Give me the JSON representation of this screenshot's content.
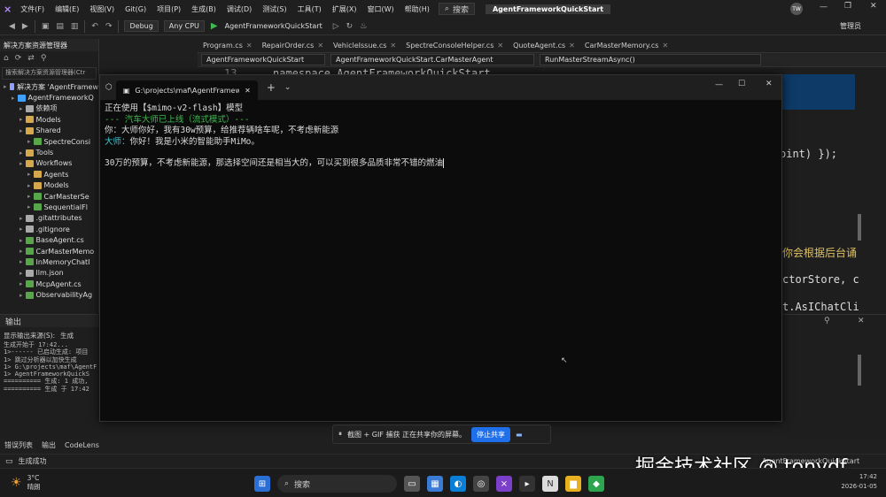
{
  "menubar": {
    "items": [
      "文件(F)",
      "编辑(E)",
      "视图(V)",
      "Git(G)",
      "项目(P)",
      "生成(B)",
      "调试(D)",
      "测试(S)",
      "工具(T)",
      "扩展(X)",
      "窗口(W)",
      "帮助(H)"
    ],
    "search_label": "搜索",
    "solution_title": "AgentFrameworkQuickStart",
    "avatar": "TW"
  },
  "toolbar": {
    "config": "Debug",
    "platform": "Any CPU",
    "run_target": "AgentFrameworkQuickStart",
    "admin": "管理员"
  },
  "solution_explorer": {
    "title": "解决方案资源管理器",
    "search_placeholder": "搜索解决方案资源管理器(Ctr",
    "items": [
      {
        "label": "解决方案 'AgentFramew",
        "indent": 0,
        "color": "#8fa0ff"
      },
      {
        "label": "AgentFrameworkQ",
        "indent": 1,
        "color": "#3fa0ff"
      },
      {
        "label": "依赖项",
        "indent": 2,
        "color": "#aaaaaa"
      },
      {
        "label": "Models",
        "indent": 2,
        "color": "#d4a84b"
      },
      {
        "label": "Shared",
        "indent": 2,
        "color": "#d4a84b"
      },
      {
        "label": "SpectreConsi",
        "indent": 3,
        "color": "#57a64a"
      },
      {
        "label": "Tools",
        "indent": 2,
        "color": "#d4a84b"
      },
      {
        "label": "Workflows",
        "indent": 2,
        "color": "#d4a84b"
      },
      {
        "label": "Agents",
        "indent": 3,
        "color": "#d4a84b"
      },
      {
        "label": "Models",
        "indent": 3,
        "color": "#d4a84b"
      },
      {
        "label": "CarMasterSe",
        "indent": 3,
        "color": "#57a64a"
      },
      {
        "label": "SequentialFl",
        "indent": 3,
        "color": "#57a64a"
      },
      {
        "label": ".gitattributes",
        "indent": 2,
        "color": "#aaaaaa"
      },
      {
        "label": ".gitignore",
        "indent": 2,
        "color": "#aaaaaa"
      },
      {
        "label": "BaseAgent.cs",
        "indent": 2,
        "color": "#57a64a"
      },
      {
        "label": "CarMasterMemo",
        "indent": 2,
        "color": "#57a64a"
      },
      {
        "label": "InMemoryChatI",
        "indent": 2,
        "color": "#57a64a"
      },
      {
        "label": "llm.json",
        "indent": 2,
        "color": "#aaaaaa"
      },
      {
        "label": "McpAgent.cs",
        "indent": 2,
        "color": "#57a64a"
      },
      {
        "label": "ObservabilityAg",
        "indent": 2,
        "color": "#57a64a"
      }
    ]
  },
  "editor": {
    "tabs": [
      "Program.cs",
      "RepairOrder.cs",
      "VehicleIssue.cs",
      "SpectreConsoleHelper.cs",
      "QuoteAgent.cs",
      "CarMasterMemory.cs"
    ],
    "nav": [
      "AgentFrameworkQuickStart",
      "AgentFrameworkQuickStart.CarMasterAgent",
      "RunMasterStreamAsync()"
    ],
    "frag1": "namespace AgentFrameworkQuickStart",
    "frag1_line": "13",
    "frag2": "oint) });",
    "frag3": "你会根据后台诵",
    "frag4": "ctorStore, c",
    "frag5": "t.AsIChatCli"
  },
  "terminal": {
    "tab_title": "G:\\projects\\maf\\AgentFramew",
    "line1": "正在使用【$mimo-v2-flash】模型",
    "line2": "--- 汽车大师已上线（流式模式）---",
    "line3": "你：大师你好，我有30w预算，给推荐辆啥车呢，不考虑新能源",
    "line4_prefix": "大师：",
    "line4": "你好！我是小米的智能助手MiMo。",
    "line5": "30万的预算，不考虑新能源，那选择空间还是相当大的，可以买到很多品质非常不错的燃油"
  },
  "output": {
    "title": "输出",
    "source_label": "显示输出来源(S):",
    "source_value": "生成",
    "lines": [
      "生成开始于 17:42...",
      "1>------ 已启动生成: 项目",
      "1>  跳过分析器以加快生成",
      "1>  G:\\projects\\maf\\AgentF",
      "1>  AgentFrameworkQuickS",
      "========== 生成: 1 成功,",
      "========== 生成 于 17:42"
    ]
  },
  "bottom_tabs": [
    "错误列表",
    "输出",
    "CodeLens"
  ],
  "status": {
    "text": "生成成功",
    "project": "AgentFrameworkQuickStart"
  },
  "share_bar": {
    "text": "截图 + GIF 捕获 正在共享你的屏幕。",
    "stop": "停止共享"
  },
  "taskbar": {
    "weather_temp": "3°C",
    "weather_desc": "晴朗",
    "search": "搜索",
    "time": "17:42",
    "date": "2026-01-05"
  },
  "watermark": "掘金技术社区 @ tonydf"
}
